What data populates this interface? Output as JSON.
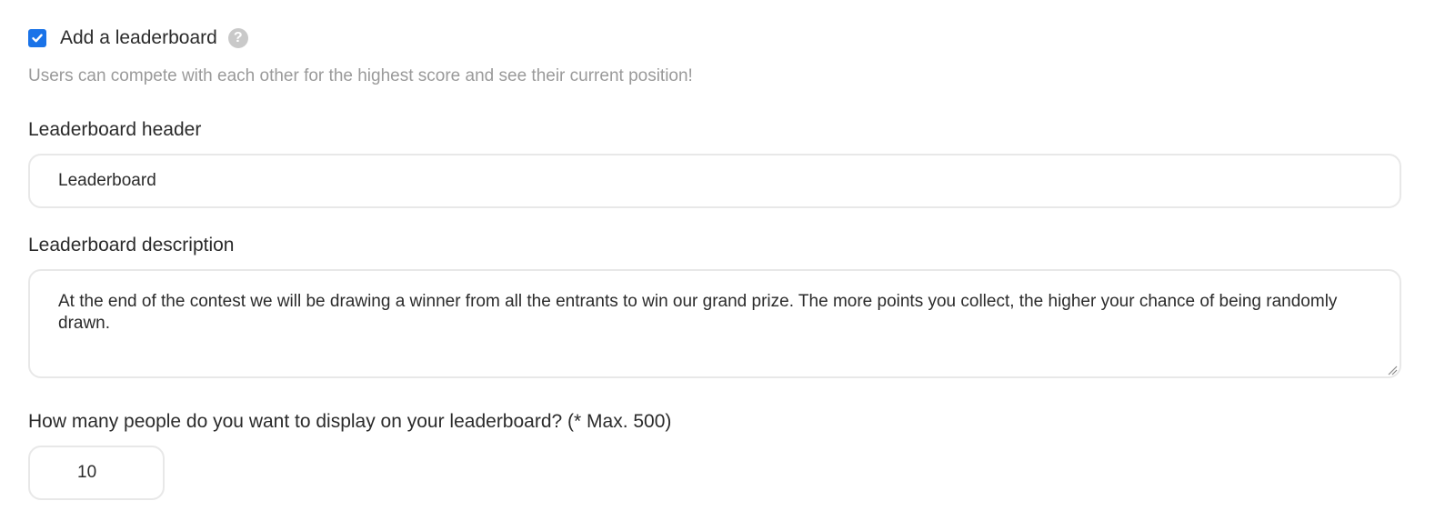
{
  "leaderboard_toggle": {
    "label": "Add a leaderboard",
    "checked": true,
    "help_icon": "question-circle-icon",
    "hint": "Users can compete with each other for the highest score and see their current position!"
  },
  "header_field": {
    "label": "Leaderboard header",
    "value": "Leaderboard"
  },
  "description_field": {
    "label": "Leaderboard description",
    "value": "At the end of the contest we will be drawing a winner from all the entrants to win our grand prize. The more points you collect, the higher your chance of being randomly drawn."
  },
  "count_field": {
    "label": "How many people do you want to display on your leaderboard? (* Max. 500)",
    "value": "10"
  },
  "colors": {
    "accent": "#1a73e8",
    "hint_text": "#9a9a9a",
    "border": "#e8e8e8"
  }
}
